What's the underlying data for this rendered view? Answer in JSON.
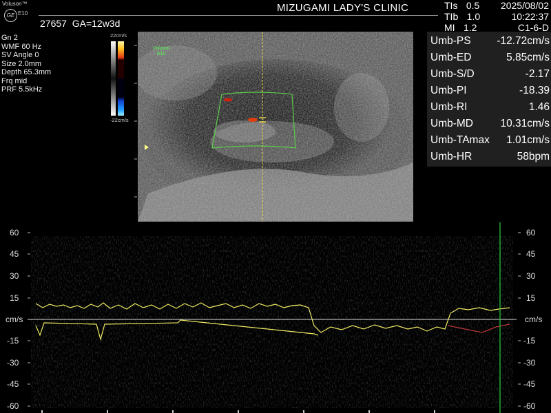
{
  "header": {
    "brand": "Voluson™",
    "brand_mark": "GE",
    "model": "E10",
    "clinic": "MIZUGAMI LADY'S CLINIC",
    "patient_id": "27657",
    "gestational_age": "GA=12w3d",
    "indices": [
      {
        "label": "TIs",
        "value": "0.5"
      },
      {
        "label": "TIb",
        "value": "1.0"
      },
      {
        "label": "MI",
        "value": "1.2"
      }
    ],
    "date": "2025/08/02",
    "time": "10:22:37",
    "probe": "C1-6-D"
  },
  "params": [
    "Gn  2",
    "WMF 60 Hz",
    "SV Angle  0",
    "Size  2.0mm",
    "Depth 65.3mm",
    "Frq mid",
    "PRF  5.5kHz"
  ],
  "color_bar": {
    "top": "22cm/s",
    "bottom": "-22cm/s"
  },
  "image_label": {
    "line1": "Voluson",
    "line2": "E10"
  },
  "measurements": [
    {
      "label": "Umb-PS",
      "value": "-12.72cm/s"
    },
    {
      "label": "Umb-ED",
      "value": "5.85cm/s"
    },
    {
      "label": "Umb-S/D",
      "value": "-2.17"
    },
    {
      "label": "Umb-PI",
      "value": "-18.39"
    },
    {
      "label": "Umb-RI",
      "value": "1.46"
    },
    {
      "label": "Umb-MD",
      "value": "10.31cm/s"
    },
    {
      "label": "Umb-TAmax",
      "value": "1.01cm/s"
    },
    {
      "label": "Umb-HR",
      "value": "58bpm"
    }
  ],
  "doppler": {
    "scale_ticks": [
      "60",
      "45",
      "30",
      "15",
      "cm/s",
      "-15",
      "-30",
      "-45",
      "-60"
    ],
    "unit": "cm/s"
  },
  "colors": {
    "trace": "#f2ec63",
    "focus_line": "#e8d84a",
    "roi_box": "#5ccf4a",
    "sweep_line": "#27c23a",
    "panel_bg": "#202020"
  }
}
